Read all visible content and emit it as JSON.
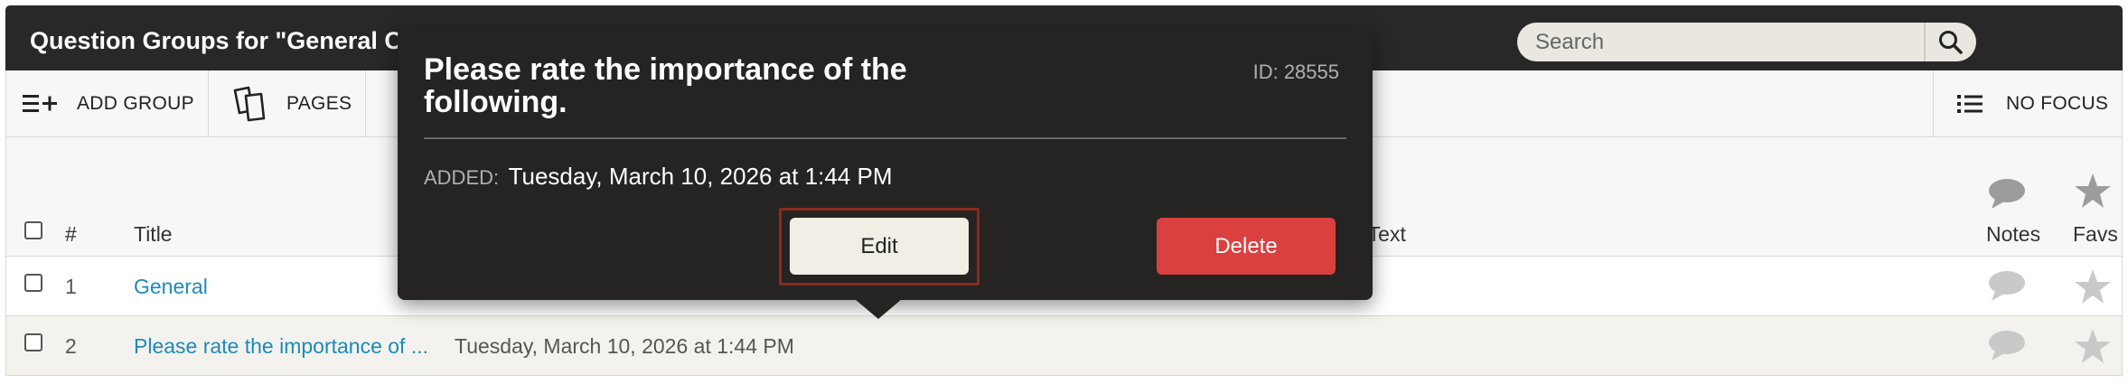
{
  "header": {
    "title": "Question Groups for \"General Consumer Survey\"",
    "search_placeholder": "Search"
  },
  "toolbar": {
    "add_group_label": "ADD GROUP",
    "pages_label": "PAGES",
    "focus_label": "NO FOCUS"
  },
  "table": {
    "columns": {
      "number": "#",
      "title": "Title",
      "closing_text": "Closing Text",
      "notes": "Notes",
      "favs": "Favs"
    },
    "rows": [
      {
        "number": "1",
        "title": "General",
        "added": ""
      },
      {
        "number": "2",
        "title": "Please rate the importance of ...",
        "added": "Tuesday, March 10, 2026 at 1:44 PM"
      }
    ]
  },
  "popover": {
    "title": "Please rate the importance of the following.",
    "id_text": "ID: 28555",
    "added_label": "ADDED:",
    "added_value": "Tuesday, March 10, 2026 at 1:44 PM",
    "edit_label": "Edit",
    "delete_label": "Delete"
  },
  "colors": {
    "header_bg": "#282828",
    "popover_bg": "#252423",
    "link": "#1d8ab8",
    "delete": "#d9403f",
    "focus_ring": "#8a2a1d"
  },
  "icons": {
    "search": "search-icon",
    "add_group": "add-list-icon",
    "pages": "pages-icon",
    "focus": "list-icon",
    "notes": "comment-icon",
    "favs": "star-icon"
  }
}
